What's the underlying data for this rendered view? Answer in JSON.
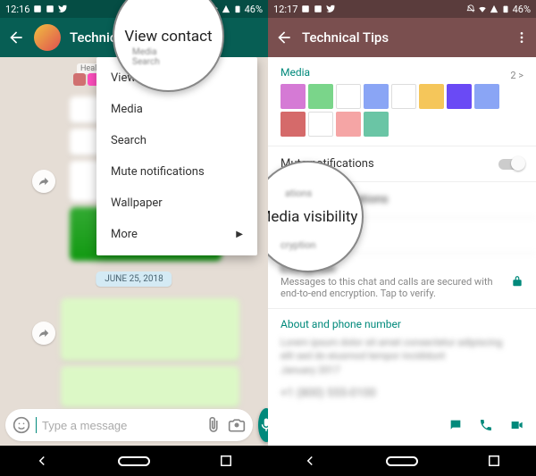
{
  "left": {
    "statusbar": {
      "time": "12:16",
      "battery": "46%"
    },
    "appbar": {
      "title": "Technical Tips"
    },
    "healthy_tag": "Healthy Living",
    "date": "JUNE 25, 2018",
    "dropdown": {
      "view_contact": "View contact",
      "media": "Media",
      "search": "Search",
      "mute": "Mute notifications",
      "wallpaper": "Wallpaper",
      "more": "More"
    },
    "input_placeholder": "Type a message",
    "magnifier": "View contact"
  },
  "right": {
    "statusbar": {
      "time": "12:17",
      "battery": "46%"
    },
    "appbar": {
      "title": "Technical Tips"
    },
    "media": {
      "label": "Media",
      "count": "2 >"
    },
    "mute": "Mute notifications",
    "custom": "Custom notifications",
    "media_vis": "Media visibility",
    "encryption": {
      "label": "Encryption",
      "desc": "Messages to this chat and calls are secured with end-to-end encryption. Tap to verify."
    },
    "about_label": "About and phone number",
    "magnifier": "Media visibility"
  }
}
